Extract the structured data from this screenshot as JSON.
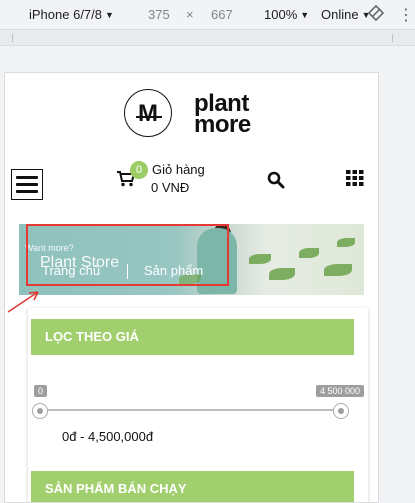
{
  "devtools": {
    "device": "iPhone 6/7/8",
    "width": "375",
    "times": "×",
    "height": "667",
    "zoom": "100%",
    "network": "Online"
  },
  "logo": {
    "monogram": "M",
    "word_line1": "plant",
    "word_line2": "more"
  },
  "header": {
    "cart_count": "0",
    "cart_label": "Giỏ hàng",
    "cart_total": "0 VNĐ"
  },
  "banner": {
    "want_more": "Want more?",
    "store_title": "Plant Store",
    "breadcrumb_home": "Trang chủ",
    "breadcrumb_products": "Sản phẩm"
  },
  "price_filter": {
    "title": "LỌC THEO GIÁ",
    "min_tip": "0",
    "max_tip": "4 500 000",
    "range_text": "0đ - 4,500,000đ"
  },
  "best_sellers": {
    "title": "SẢN PHẨM BÁN CHẠY"
  },
  "colors": {
    "accent_green": "#a2cf6e",
    "badge_green": "#9ccc65",
    "annotation_red": "#e53935"
  }
}
